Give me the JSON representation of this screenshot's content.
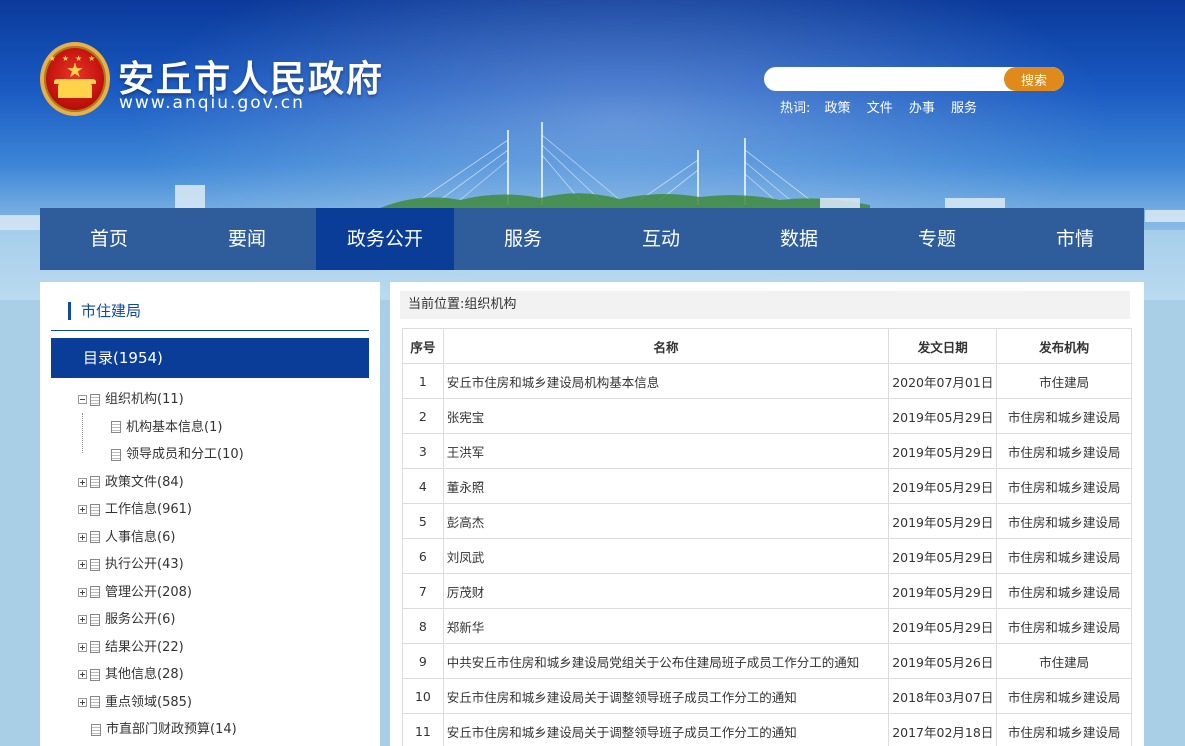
{
  "site": {
    "title": "安丘市人民政府",
    "url": "www.anqiu.gov.cn"
  },
  "search": {
    "placeholder": "",
    "button": "搜索",
    "hot_label": "热词:",
    "hot_words": [
      "政策",
      "文件",
      "办事",
      "服务"
    ]
  },
  "nav": {
    "items": [
      "首页",
      "要闻",
      "政务公开",
      "服务",
      "互动",
      "数据",
      "专题",
      "市情"
    ],
    "active_index": 2
  },
  "sidebar": {
    "title": "市住建局",
    "category": "目录(1954)",
    "tree": [
      {
        "label": "组织机构(11)",
        "toggle": "minus",
        "level": 0
      },
      {
        "label": "机构基本信息(1)",
        "toggle": "none",
        "level": 1
      },
      {
        "label": "领导成员和分工(10)",
        "toggle": "none",
        "level": 1
      },
      {
        "label": "政策文件(84)",
        "toggle": "plus",
        "level": 0
      },
      {
        "label": "工作信息(961)",
        "toggle": "plus",
        "level": 0
      },
      {
        "label": "人事信息(6)",
        "toggle": "plus",
        "level": 0
      },
      {
        "label": "执行公开(43)",
        "toggle": "plus",
        "level": 0
      },
      {
        "label": "管理公开(208)",
        "toggle": "plus",
        "level": 0
      },
      {
        "label": "服务公开(6)",
        "toggle": "plus",
        "level": 0
      },
      {
        "label": "结果公开(22)",
        "toggle": "plus",
        "level": 0
      },
      {
        "label": "其他信息(28)",
        "toggle": "plus",
        "level": 0
      },
      {
        "label": "重点领域(585)",
        "toggle": "plus",
        "level": 0
      },
      {
        "label": "市直部门财政预算(14)",
        "toggle": "none",
        "level": 0
      }
    ]
  },
  "main": {
    "breadcrumb": "当前位置:组织机构",
    "columns": [
      "序号",
      "名称",
      "发文日期",
      "发布机构"
    ],
    "rows": [
      {
        "no": "1",
        "name": "安丘市住房和城乡建设局机构基本信息",
        "date": "2020年07月01日",
        "org": "市住建局"
      },
      {
        "no": "2",
        "name": "张宪宝",
        "date": "2019年05月29日",
        "org": "市住房和城乡建设局"
      },
      {
        "no": "3",
        "name": "王洪军",
        "date": "2019年05月29日",
        "org": "市住房和城乡建设局"
      },
      {
        "no": "4",
        "name": "董永照",
        "date": "2019年05月29日",
        "org": "市住房和城乡建设局"
      },
      {
        "no": "5",
        "name": "彭高杰",
        "date": "2019年05月29日",
        "org": "市住房和城乡建设局"
      },
      {
        "no": "6",
        "name": "刘凤武",
        "date": "2019年05月29日",
        "org": "市住房和城乡建设局"
      },
      {
        "no": "7",
        "name": "厉茂财",
        "date": "2019年05月29日",
        "org": "市住房和城乡建设局"
      },
      {
        "no": "8",
        "name": "郑新华",
        "date": "2019年05月29日",
        "org": "市住房和城乡建设局"
      },
      {
        "no": "9",
        "name": "中共安丘市住房和城乡建设局党组关于公布住建局班子成员工作分工的通知",
        "date": "2019年05月26日",
        "org": "市住建局"
      },
      {
        "no": "10",
        "name": "安丘市住房和城乡建设局关于调整领导班子成员工作分工的通知",
        "date": "2018年03月07日",
        "org": "市住房和城乡建设局"
      },
      {
        "no": "11",
        "name": "安丘市住房和城乡建设局关于调整领导班子成员工作分工的通知",
        "date": "2017年02月18日",
        "org": "市住房和城乡建设局"
      }
    ]
  }
}
